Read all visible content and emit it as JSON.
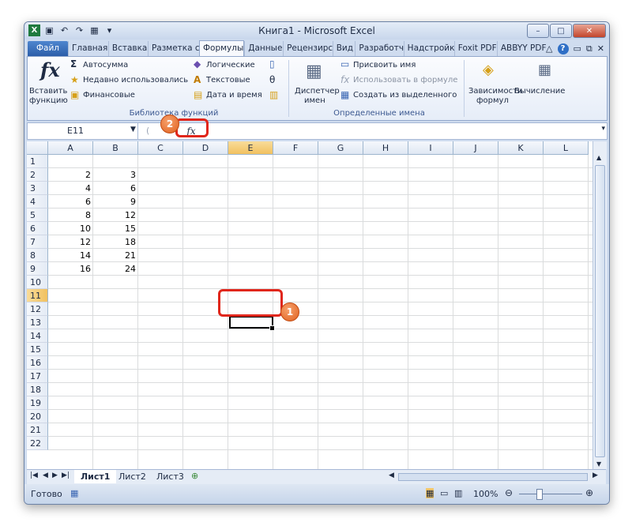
{
  "window": {
    "title": "Книга1 - Microsoft Excel",
    "qat_icons": [
      "excel-logo-icon",
      "save-icon",
      "undo-icon",
      "redo-icon",
      "form-icon",
      "customize-icon"
    ]
  },
  "tabs": {
    "file": "Файл",
    "items": [
      "Главная",
      "Вставка",
      "Разметка с",
      "Формулы",
      "Данные",
      "Рецензирс",
      "Вид",
      "Разработч",
      "Надстройк",
      "Foxit PDF",
      "ABBYY PDF"
    ],
    "active": "Формулы"
  },
  "ribbon": {
    "insert_function": {
      "line1": "Вставить",
      "line2": "функцию"
    },
    "autosum": "Автосумма",
    "recent": "Недавно использовались",
    "financial": "Финансовые",
    "logical": "Логические",
    "text": "Текстовые",
    "datetime": "Дата и время",
    "library_label": "Библиотека функций",
    "name_manager": {
      "line1": "Диспетчер",
      "line2": "имен"
    },
    "define_name": "Присвоить имя",
    "use_in_formula": "Использовать в формуле",
    "create_from_selection": "Создать из выделенного",
    "defined_names_label": "Определенные имена",
    "dependencies": {
      "line1": "Зависимости",
      "line2": "формул"
    },
    "calculation": "Вычисление"
  },
  "formula_bar": {
    "name_box": "E11",
    "fx": "fx",
    "value": ""
  },
  "columns": [
    "A",
    "B",
    "C",
    "D",
    "E",
    "F",
    "G",
    "H",
    "I",
    "J",
    "K",
    "L"
  ],
  "selected_column": "E",
  "rows": [
    "1",
    "2",
    "3",
    "4",
    "5",
    "6",
    "7",
    "8",
    "9",
    "10",
    "11",
    "12",
    "13",
    "14",
    "15",
    "16",
    "17",
    "18",
    "19",
    "20",
    "21",
    "22"
  ],
  "selected_row": "11",
  "cells": {
    "A": [
      "",
      "2",
      "4",
      "6",
      "8",
      "10",
      "12",
      "14",
      "16"
    ],
    "B": [
      "",
      "3",
      "6",
      "9",
      "12",
      "15",
      "18",
      "21",
      "24"
    ]
  },
  "sheets": {
    "items": [
      "Лист1",
      "Лист2",
      "Лист3"
    ],
    "active": "Лист1"
  },
  "status": {
    "ready": "Готово",
    "zoom": "100%"
  },
  "callouts": {
    "one": "1",
    "two": "2"
  }
}
